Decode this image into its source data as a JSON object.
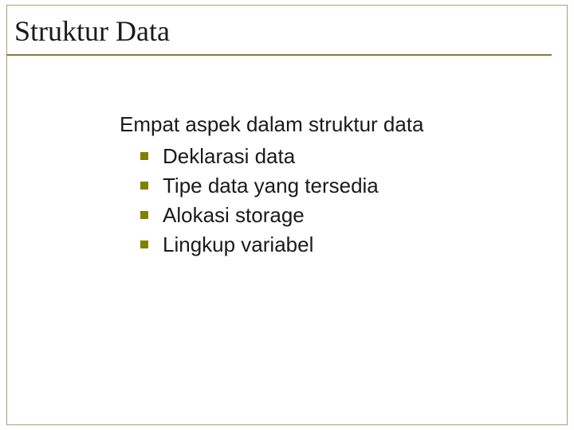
{
  "slide": {
    "title": "Struktur Data",
    "lead": "Empat aspek dalam struktur data",
    "bullets": {
      "0": "Deklarasi data",
      "1": "Tipe data yang tersedia",
      "2": "Alokasi storage",
      "3": "Lingkup variabel"
    }
  }
}
